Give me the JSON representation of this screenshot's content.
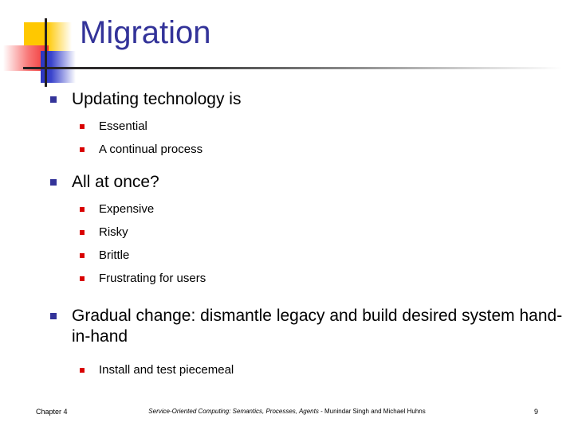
{
  "slide": {
    "title": "Migration",
    "title_color": "#333399",
    "bullet_level1_color": "#333399",
    "bullet_level2_color": "#D90000",
    "background_color": "#FFFFFF",
    "content": [
      {
        "level": 1,
        "text": "Updating technology is"
      },
      {
        "level": 2,
        "text": "Essential"
      },
      {
        "level": 2,
        "text": "A continual process"
      },
      {
        "level": 1,
        "text": "All at once?"
      },
      {
        "level": 2,
        "text": "Expensive"
      },
      {
        "level": 2,
        "text": "Risky"
      },
      {
        "level": 2,
        "text": "Brittle"
      },
      {
        "level": 2,
        "text": "Frustrating for users"
      },
      {
        "level": 1,
        "text": "Gradual change: dismantle legacy and build desired system hand-in-hand"
      },
      {
        "level": 2,
        "text": "Install and test piecemeal"
      }
    ]
  },
  "footer": {
    "chapter": "Chapter 4",
    "citation_title": "Service-Oriented Computing: Semantics, Processes, Agents",
    "citation_authors": " - Munindar Singh and Michael Huhns",
    "page_number": "9"
  },
  "decoration": {
    "name": "corner-logo",
    "yellow": "#FFC800",
    "red": "#F03030",
    "blue": "#2B35C0",
    "line": "#231F20"
  }
}
